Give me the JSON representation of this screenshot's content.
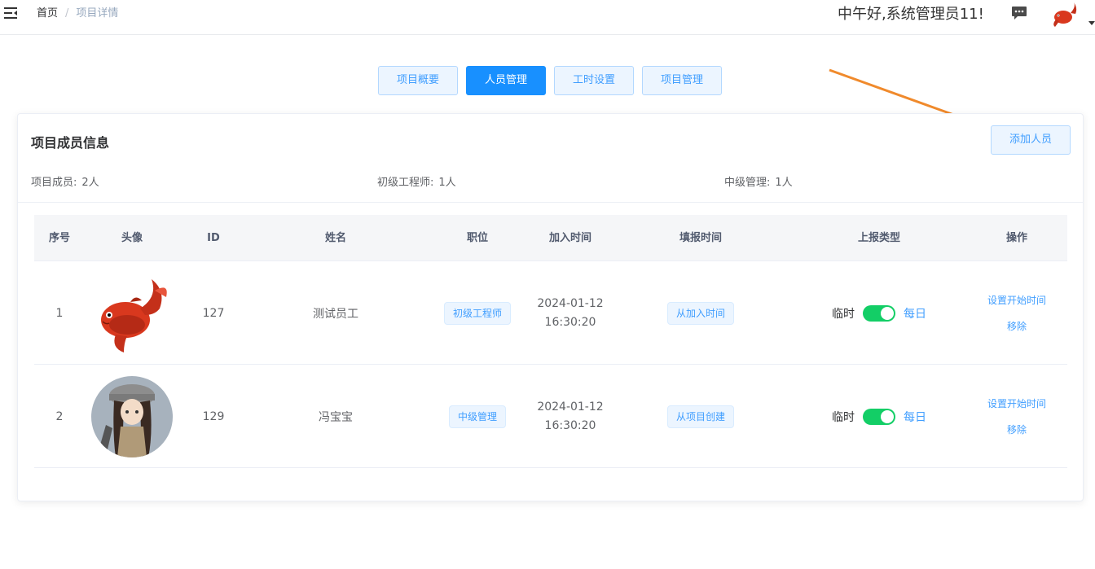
{
  "header": {
    "breadcrumb": {
      "home": "首页",
      "separator": "/",
      "current": "项目详情"
    },
    "greeting": "中午好,系统管理员11!",
    "icons": {
      "menu": "menu-fold-icon",
      "message": "message-icon",
      "avatar": "koi-fish-avatar"
    }
  },
  "tabs": [
    {
      "label": "项目概要",
      "active": false
    },
    {
      "label": "人员管理",
      "active": true
    },
    {
      "label": "工时设置",
      "active": false
    },
    {
      "label": "项目管理",
      "active": false
    }
  ],
  "card": {
    "title": "项目成员信息",
    "add_button": "添加人员",
    "summary": [
      {
        "label": "项目成员:",
        "value": "2人"
      },
      {
        "label": "初级工程师:",
        "value": "1人"
      },
      {
        "label": "中级管理:",
        "value": "1人"
      }
    ]
  },
  "table": {
    "columns": [
      "序号",
      "头像",
      "ID",
      "姓名",
      "职位",
      "加入时间",
      "填报时间",
      "上报类型",
      "操作"
    ],
    "rows": [
      {
        "index": "1",
        "avatar": "koi-fish-avatar",
        "id": "127",
        "name": "测试员工",
        "position": "初级工程师",
        "join_date": "2024-01-12",
        "join_time": "16:30:20",
        "report_time": "从加入时间",
        "type_off": "临时",
        "type_on": "每日",
        "switch_on": true,
        "op_set": "设置开始时间",
        "op_remove": "移除"
      },
      {
        "index": "2",
        "avatar": "anime-girl-avatar",
        "id": "129",
        "name": "冯宝宝",
        "position": "中级管理",
        "join_date": "2024-01-12",
        "join_time": "16:30:20",
        "report_time": "从项目创建",
        "type_off": "临时",
        "type_on": "每日",
        "switch_on": true,
        "op_set": "设置开始时间",
        "op_remove": "移除"
      }
    ]
  },
  "colors": {
    "primary": "#1890ff",
    "link": "#409eff",
    "switch_on": "#13ce66",
    "arrow": "#f08a2c"
  }
}
